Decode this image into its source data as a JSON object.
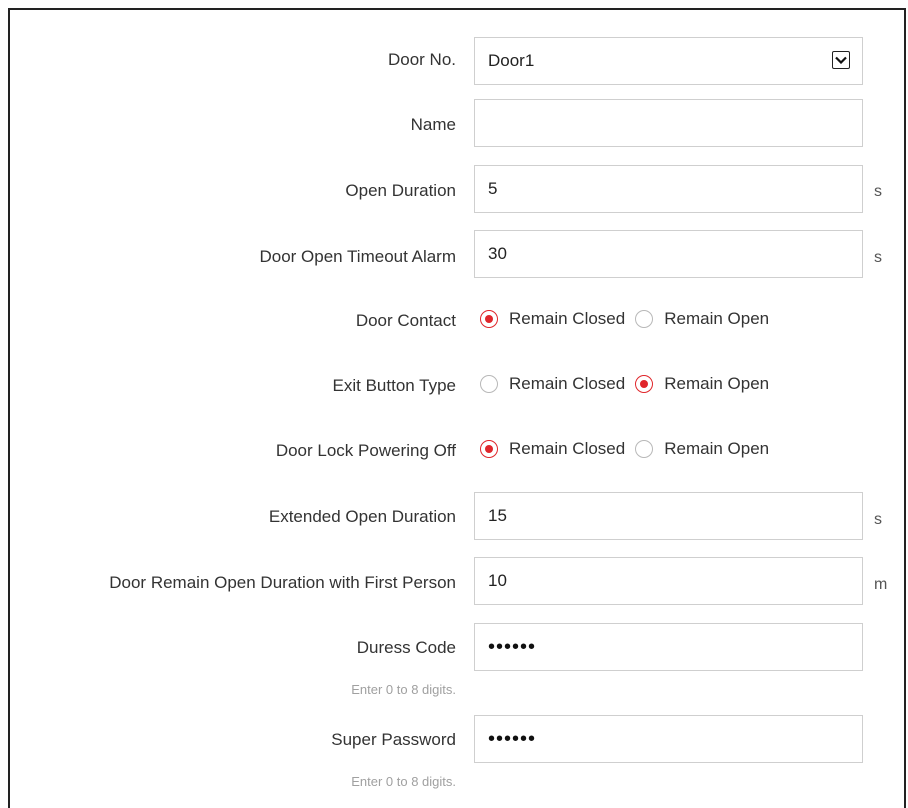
{
  "door_no": {
    "label": "Door No.",
    "value": "Door1"
  },
  "name": {
    "label": "Name",
    "value": ""
  },
  "open_duration": {
    "label": "Open Duration",
    "value": "5",
    "unit": "s"
  },
  "door_open_timeout_alarm": {
    "label": "Door Open Timeout Alarm",
    "value": "30",
    "unit": "s"
  },
  "door_contact": {
    "label": "Door Contact",
    "options": [
      "Remain Closed",
      "Remain Open"
    ],
    "selected": "Remain Closed"
  },
  "exit_button_type": {
    "label": "Exit Button Type",
    "options": [
      "Remain Closed",
      "Remain Open"
    ],
    "selected": "Remain Open"
  },
  "door_lock_powering_off": {
    "label": "Door Lock Powering Off",
    "options": [
      "Remain Closed",
      "Remain Open"
    ],
    "selected": "Remain Closed"
  },
  "extended_open_duration": {
    "label": "Extended Open Duration",
    "value": "15",
    "unit": "s"
  },
  "first_person_duration": {
    "label": "Door Remain Open Duration with First Person",
    "value": "10",
    "unit": "m"
  },
  "duress_code": {
    "label": "Duress Code",
    "value": "••••••",
    "hint": "Enter 0 to 8 digits."
  },
  "super_password": {
    "label": "Super Password",
    "value": "••••••",
    "hint": "Enter 0 to 8 digits."
  },
  "colors": {
    "radio_selected": "#e0262b",
    "border": "#cfcfcf",
    "hint": "#a0a0a0"
  },
  "icons": {
    "dropdown": "chevron-down-icon"
  }
}
